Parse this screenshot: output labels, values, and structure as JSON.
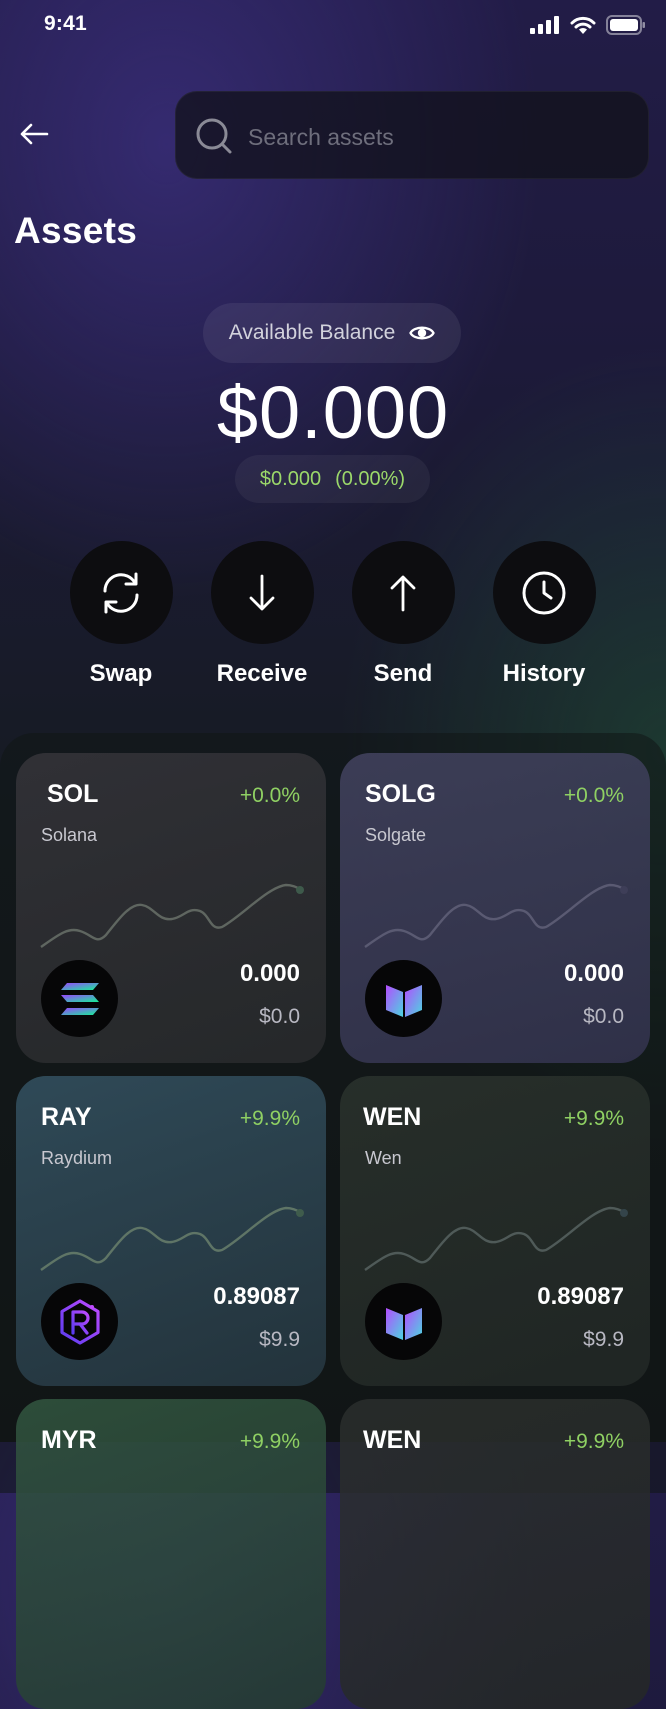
{
  "status_bar": {
    "time": "9:41"
  },
  "search": {
    "placeholder": "Search assets"
  },
  "page_title": "Assets",
  "balance": {
    "label": "Available Balance",
    "amount": "$0.000",
    "change_value": "$0.000",
    "change_percent": "(0.00%)"
  },
  "actions": [
    {
      "label": "Swap",
      "icon": "swap-icon"
    },
    {
      "label": "Receive",
      "icon": "arrow-down-icon"
    },
    {
      "label": "Send",
      "icon": "arrow-up-icon"
    },
    {
      "label": "History",
      "icon": "clock-icon"
    }
  ],
  "colors": {
    "positive": "#8fd063",
    "accent_purple": "#8a5cf6"
  },
  "assets": [
    {
      "symbol": "SOL",
      "name": "Solana",
      "change": "+0.0%",
      "amount": "0.000",
      "usd": "$0.0",
      "logo": "solana-logo-icon"
    },
    {
      "symbol": "SOLG",
      "name": "Solgate",
      "change": "+0.0%",
      "amount": "0.000",
      "usd": "$0.0",
      "logo": "solgate-logo-icon"
    },
    {
      "symbol": "RAY",
      "name": "Raydium",
      "change": "+9.9%",
      "amount": "0.89087",
      "usd": "$9.9",
      "logo": "raydium-logo-icon"
    },
    {
      "symbol": "WEN",
      "name": "Wen",
      "change": "+9.9%",
      "amount": "0.89087",
      "usd": "$9.9",
      "logo": "wen-logo-icon"
    },
    {
      "symbol": "MYR",
      "name": "",
      "change": "+9.9%",
      "amount": "",
      "usd": "",
      "logo": ""
    },
    {
      "symbol": "WEN",
      "name": "",
      "change": "+9.9%",
      "amount": "",
      "usd": "",
      "logo": ""
    }
  ]
}
